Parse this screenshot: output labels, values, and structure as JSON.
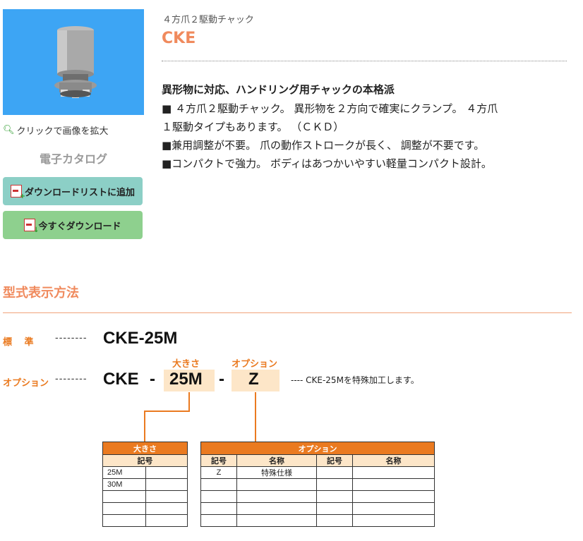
{
  "sidebar": {
    "zoom_label": "クリックで画像を拡大",
    "catalog_title": "電子カタログ",
    "add_list_label": "ダウンロードリストに追加",
    "download_now_label": "今すぐダウンロード"
  },
  "product": {
    "subtitle": "４方爪２駆動チャック",
    "model": "CKE",
    "headline": "異形物に対応、ハンドリング用チャックの本格派",
    "bullets": [
      "■ ４方爪２駆動チャック。 異形物を２方向で確実にクランプ。 ４方爪",
      "１駆動タイプもあります。 （ＣＫＤ）",
      "■兼用調整が不要。 爪の動作ストロークが長く、 調整が不要です。",
      "■コンパクトで強力。 ボディはあつかいやすい軽量コンパクト設計。"
    ]
  },
  "section": {
    "title": "型式表示方法"
  },
  "diagram": {
    "standard_label": "標　 準",
    "standard_code": "CKE-25M",
    "option_label": "オプション",
    "option_prefix": "CKE",
    "hyphen": "-",
    "size_label": "大きさ",
    "size_value": "25M",
    "option_box_label": "オプション",
    "option_value": "Z",
    "leader": "--------",
    "note": "---- CKE-25Mを特殊加工します。"
  },
  "size_table": {
    "title": "大きさ",
    "column": "記号",
    "rows": [
      "25M",
      "30M",
      "",
      "",
      ""
    ]
  },
  "option_table": {
    "title": "オプション",
    "columns": [
      "記号",
      "名称",
      "記号",
      "名称"
    ],
    "rows": [
      [
        "Z",
        "特殊仕様",
        "",
        ""
      ],
      [
        "",
        "",
        "",
        ""
      ],
      [
        "",
        "",
        "",
        ""
      ],
      [
        "",
        "",
        "",
        ""
      ],
      [
        "",
        "",
        "",
        ""
      ]
    ]
  },
  "colors": {
    "accent_orange": "#f08a5d",
    "image_bg": "#3da5f4",
    "add_button": "#8ccfc6",
    "download_button": "#8ed08e"
  }
}
